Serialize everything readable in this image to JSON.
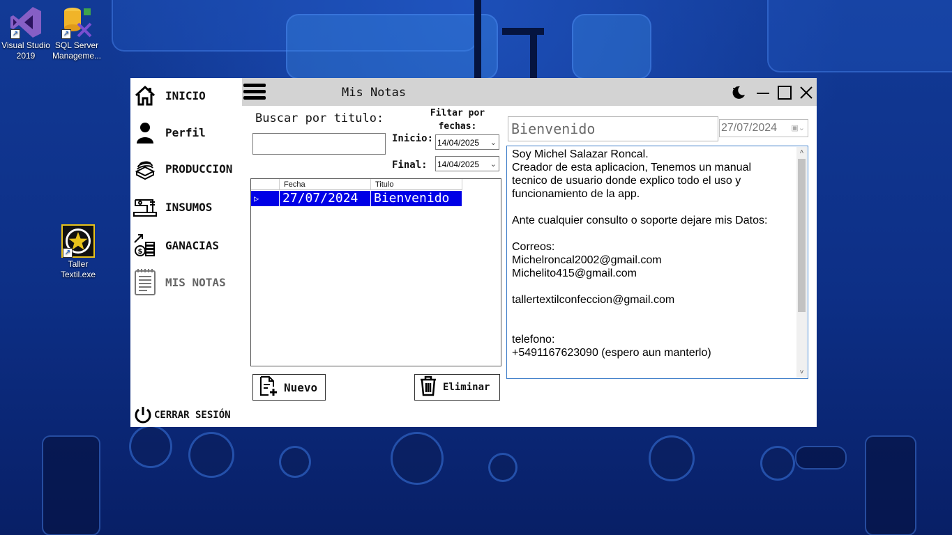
{
  "desktop": {
    "icons": [
      {
        "label": "Visual Studio 2019"
      },
      {
        "label": "SQL Server Manageme..."
      },
      {
        "label": "Taller Textil.exe"
      }
    ]
  },
  "sidebar": {
    "items": [
      {
        "label": "INICIO",
        "icon": "home-icon"
      },
      {
        "label": "Perfil",
        "icon": "user-icon"
      },
      {
        "label": "PRODUCCION",
        "icon": "fabric-stack-icon"
      },
      {
        "label": "INSUMOS",
        "icon": "sewing-machine-icon"
      },
      {
        "label": "GANACIAS",
        "icon": "money-growth-icon"
      },
      {
        "label": "MIS NOTAS",
        "icon": "notepad-icon"
      }
    ],
    "logout_label": "CERRAR SESIÓN"
  },
  "window": {
    "title": "Mis Notas"
  },
  "search": {
    "label": "Buscar por titulo:",
    "value": ""
  },
  "filter": {
    "label": "Filtar por fechas:",
    "start_label": "Inicio:",
    "start_value": "14/04/2025",
    "end_label": "Final:",
    "end_value": "14/04/2025"
  },
  "grid": {
    "columns": [
      "Fecha",
      "Titulo"
    ],
    "rows": [
      {
        "fecha": "27/07/2024",
        "titulo": "Bienvenido",
        "selected": true
      }
    ]
  },
  "buttons": {
    "new_label": "Nuevo",
    "delete_label": "Eliminar"
  },
  "note": {
    "title": "Bienvenido",
    "date": "27/07/2024",
    "lines": [
      "Soy Michel Salazar Roncal.",
      "Creador de esta aplicacion, Tenemos un manual",
      "tecnico de usuario donde explico todo el uso y",
      "funcionamiento de la app.",
      "",
      "Ante cualquier consulto o soporte dejare mis Datos:",
      "",
      "Correos:",
      "Michelroncal2002@gmail.com",
      "Michelito415@gmail.com",
      "",
      "tallertextilconfeccion@gmail.com",
      "",
      "",
      "telefono:",
      "+5491167623090 (espero aun manterlo)"
    ]
  },
  "colors": {
    "selection": "#0000e6",
    "titlebar": "#d3d3d3",
    "note_border": "#3a7bc8"
  }
}
